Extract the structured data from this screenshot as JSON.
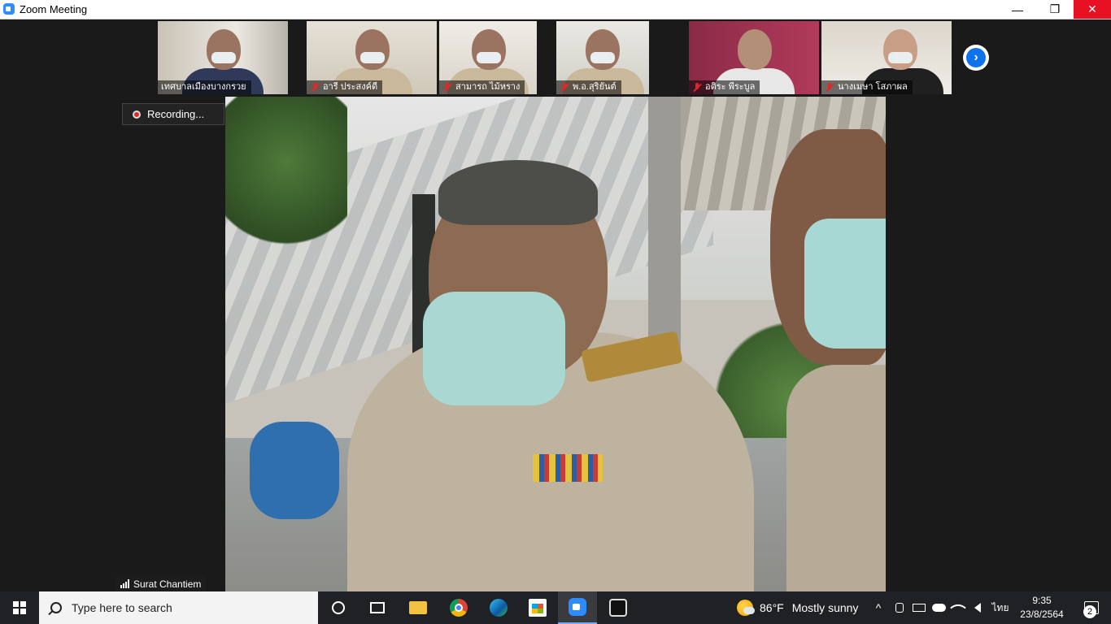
{
  "window": {
    "title": "Zoom Meeting",
    "controls": {
      "minimize": "—",
      "restore": "❐",
      "close": "✕"
    }
  },
  "participants": [
    {
      "name": "เทศบาลเมืองบางกรวย",
      "muted": false
    },
    {
      "name": "อารี ประสงค์ดี",
      "muted": true
    },
    {
      "name": "สามารถ ไม้หราง",
      "muted": true
    },
    {
      "name": "พ.อ.สุริยันต์",
      "muted": true
    },
    {
      "name": "อติระ พีระบูล",
      "muted": true
    },
    {
      "name": "นางเมษา โสภาผล",
      "muted": true
    }
  ],
  "next_page_arrow": "›",
  "recording": {
    "label": "Recording..."
  },
  "active_speaker": {
    "name": "Surat Chantiem"
  },
  "taskbar": {
    "search_placeholder": "Type here to search",
    "weather": {
      "temp": "86°F",
      "condition": "Mostly sunny"
    },
    "language": "ไทย",
    "clock": {
      "time": "9:35",
      "date": "23/8/2564"
    },
    "notifications_count": "2",
    "tray_chevron": "^"
  },
  "colors": {
    "zoom_blue": "#2d8cff",
    "close_red": "#e81123",
    "muted_red": "#e02828",
    "taskbar_bg": "#202124"
  }
}
